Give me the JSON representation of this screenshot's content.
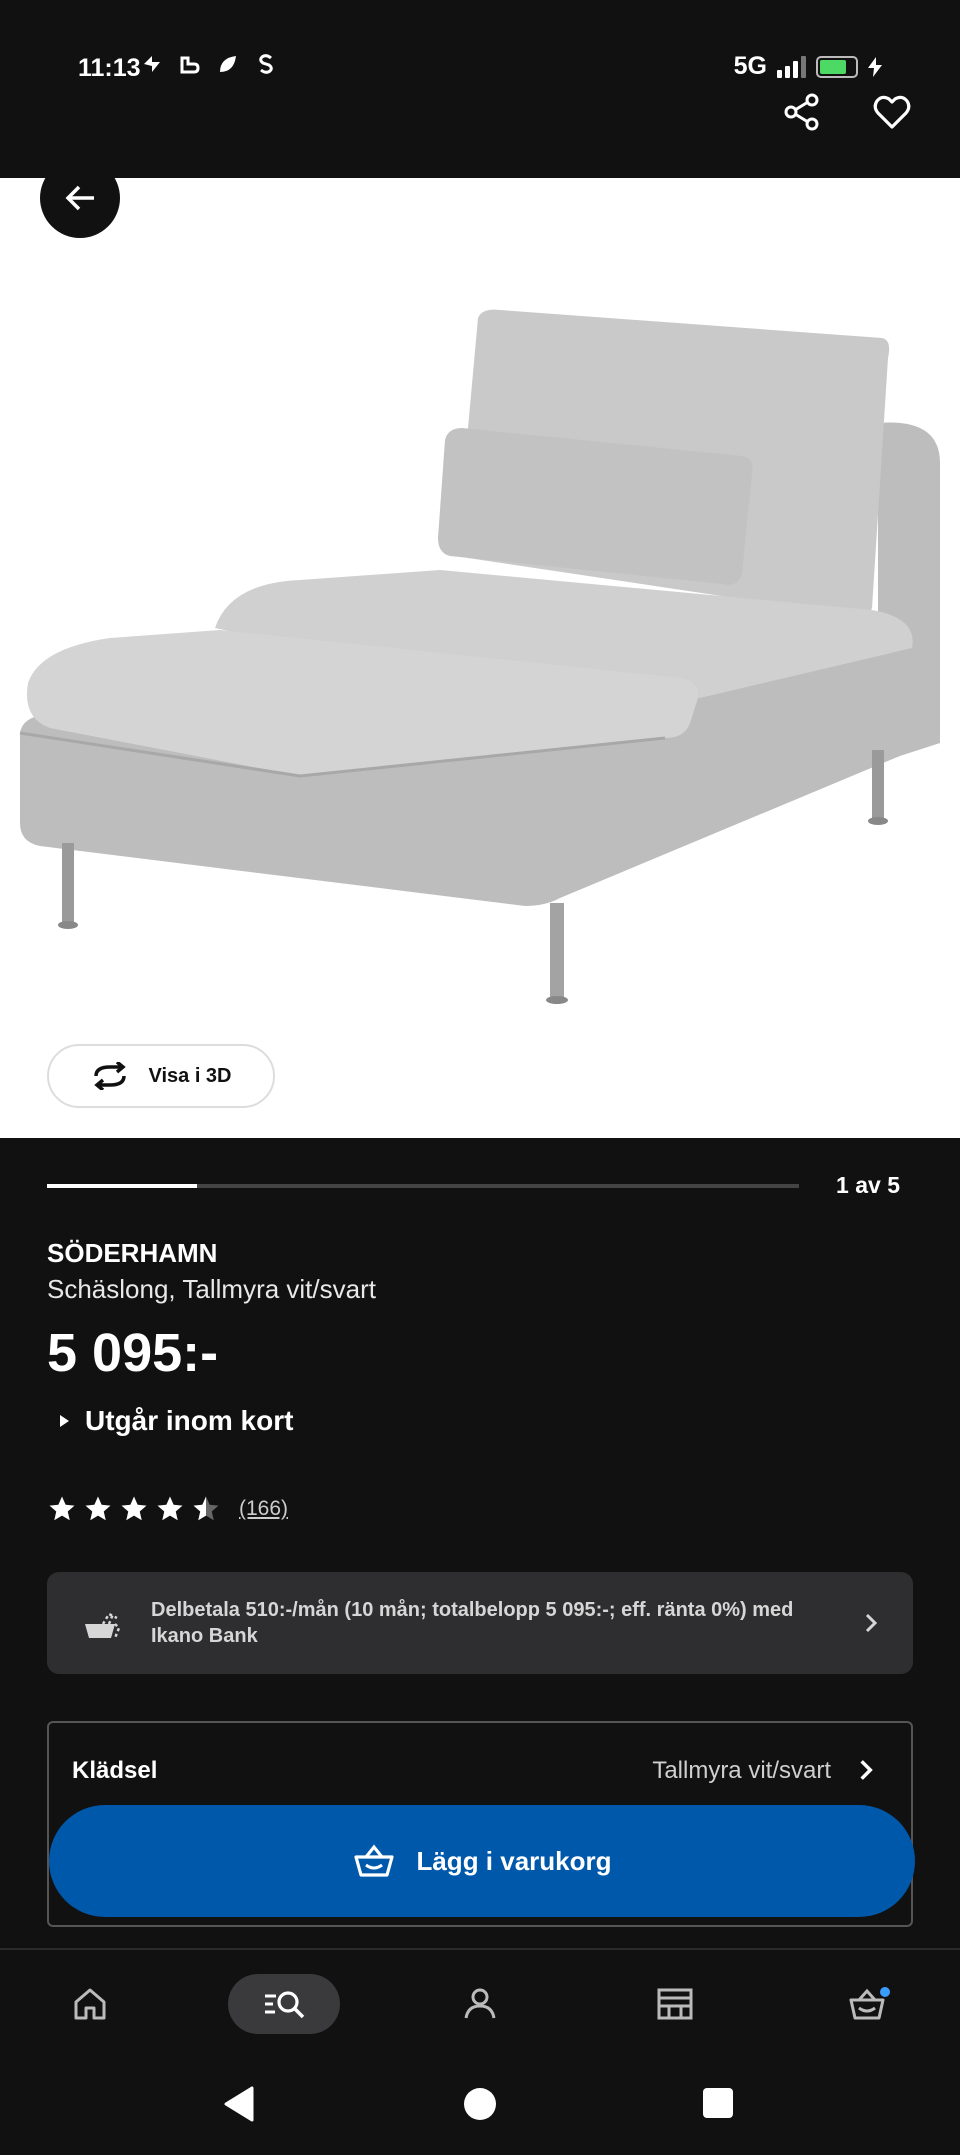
{
  "status_bar": {
    "time": "11:13",
    "network": "5G",
    "battery_color": "#4cd964"
  },
  "top_actions": {
    "share_icon": "share-icon",
    "favorite_icon": "heart-icon"
  },
  "gallery": {
    "view_3d_label": "Visa i 3D",
    "page_indicator": "1 av 5",
    "progress_fraction": 0.2
  },
  "product": {
    "brand": "SÖDERHAMN",
    "subtitle": "Schäslong, Tallmyra vit/svart",
    "price": "5 095:-",
    "availability": "Utgår inom kort",
    "rating": 4.5,
    "review_count": "(166)"
  },
  "finance": {
    "text": "Delbetala 510:-/mån (10 mån; totalbelopp 5 095:-; eff. ränta 0%) med Ikano Bank"
  },
  "option": {
    "label": "Klädsel",
    "value": "Tallmyra vit/svart"
  },
  "cart_button": {
    "label": "Lägg i varukorg",
    "color": "#0058ab"
  },
  "bottom_nav": {
    "items": [
      "home-icon",
      "search-icon",
      "account-icon",
      "store-icon",
      "cart-icon"
    ],
    "active": "search-icon",
    "badge_color": "#3b9cff"
  }
}
